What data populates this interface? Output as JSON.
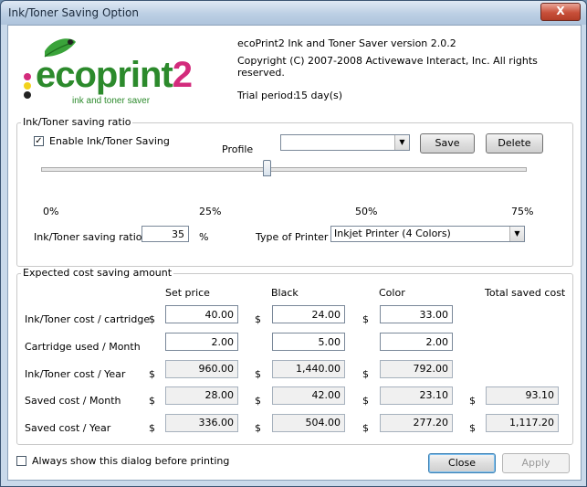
{
  "window": {
    "title": "Ink/Toner Saving Option",
    "close_glyph": "X"
  },
  "logo": {
    "brand_main": "ecoprint",
    "brand_num": "2",
    "tagline": "ink and toner saver"
  },
  "about": {
    "version": "ecoPrint2 Ink and Toner Saver version 2.0.2",
    "copyright": "Copyright (C) 2007-2008 Activewave Interact, Inc. All rights reserved.",
    "trial_label": "Trial period:",
    "trial_value": "15 day(s)"
  },
  "ratio_group": {
    "legend": "Ink/Toner saving ratio",
    "enable_label": "Enable Ink/Toner Saving",
    "enable_checked": true,
    "profile_label": "Profile",
    "profile_value": "",
    "save_label": "Save",
    "delete_label": "Delete",
    "slider_fraction": 0.35,
    "ticks": [
      "0%",
      "25%",
      "50%",
      "75%"
    ],
    "ratio_label": "Ink/Toner saving ratio",
    "ratio_value": "35",
    "ratio_unit": "%",
    "printer_type_label": "Type of Printer",
    "printer_type_value": "Inkjet Printer (4 Colors)"
  },
  "cost_group": {
    "legend": "Expected cost saving amount",
    "headers": {
      "set_price": "Set price",
      "black": "Black",
      "color": "Color",
      "total": "Total saved cost"
    },
    "currency": "$",
    "rows": [
      {
        "label": "Ink/Toner cost / cartridge",
        "set_price": "40.00",
        "black": "24.00",
        "color": "33.00"
      },
      {
        "label": "Cartridge used / Month",
        "set_price": "2.00",
        "black": "5.00",
        "color": "2.00"
      },
      {
        "label": "Ink/Toner cost / Year",
        "set_price": "960.00",
        "black": "1,440.00",
        "color": "792.00"
      },
      {
        "label": "Saved cost / Month",
        "set_price": "28.00",
        "black": "42.00",
        "color": "23.10",
        "total": "93.10"
      },
      {
        "label": "Saved cost / Year",
        "set_price": "336.00",
        "black": "504.00",
        "color": "277.20",
        "total": "1,117.20"
      }
    ]
  },
  "footer": {
    "always_show_label": "Always show this dialog before printing",
    "always_show_checked": false,
    "close_label": "Close",
    "apply_label": "Apply"
  }
}
